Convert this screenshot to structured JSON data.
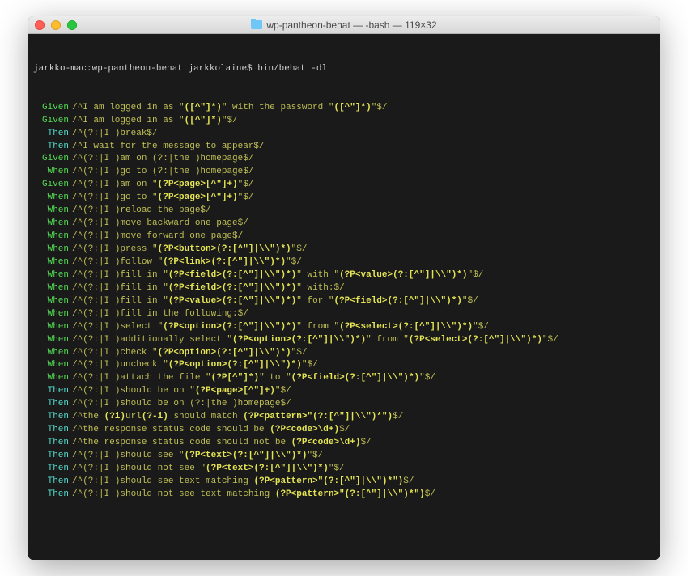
{
  "window": {
    "title_folder": "wp-pantheon-behat",
    "title_rest": " — -bash — 119×32"
  },
  "prompt": {
    "host": "jarkko-mac:",
    "dir": "wp-pantheon-behat",
    "user": " jarkkolaine$ ",
    "cmd": "bin/behat -dl"
  },
  "lines": [
    {
      "kw": "Given",
      "kwc": "given",
      "segs": [
        {
          "t": "/^I am logged in as \""
        },
        {
          "t": "([^\"]*)",
          "h": 1
        },
        {
          "t": "\" with the password \""
        },
        {
          "t": "([^\"]*)",
          "h": 1
        },
        {
          "t": "\"$/"
        }
      ]
    },
    {
      "kw": "Given",
      "kwc": "given",
      "segs": [
        {
          "t": "/^I am logged in as \""
        },
        {
          "t": "([^\"]*)",
          "h": 1
        },
        {
          "t": "\"$/"
        }
      ]
    },
    {
      "kw": "Then",
      "kwc": "then",
      "segs": [
        {
          "t": "/^(?:|I )break$/"
        }
      ]
    },
    {
      "kw": "Then",
      "kwc": "then",
      "segs": [
        {
          "t": "/^I wait for the message to appear$/"
        }
      ]
    },
    {
      "kw": "Given",
      "kwc": "given",
      "segs": [
        {
          "t": "/^(?:|I )am on (?:|the )homepage$/"
        }
      ]
    },
    {
      "kw": "When",
      "kwc": "when",
      "segs": [
        {
          "t": "/^(?:|I )go to (?:|the )homepage$/"
        }
      ]
    },
    {
      "kw": "Given",
      "kwc": "given",
      "segs": [
        {
          "t": "/^(?:|I )am on \""
        },
        {
          "t": "(?P<page>[^\"]+)",
          "h": 1
        },
        {
          "t": "\"$/"
        }
      ]
    },
    {
      "kw": "When",
      "kwc": "when",
      "segs": [
        {
          "t": "/^(?:|I )go to \""
        },
        {
          "t": "(?P<page>[^\"]+)",
          "h": 1
        },
        {
          "t": "\"$/"
        }
      ]
    },
    {
      "kw": "When",
      "kwc": "when",
      "segs": [
        {
          "t": "/^(?:|I )reload the page$/"
        }
      ]
    },
    {
      "kw": "When",
      "kwc": "when",
      "segs": [
        {
          "t": "/^(?:|I )move backward one page$/"
        }
      ]
    },
    {
      "kw": "When",
      "kwc": "when",
      "segs": [
        {
          "t": "/^(?:|I )move forward one page$/"
        }
      ]
    },
    {
      "kw": "When",
      "kwc": "when",
      "segs": [
        {
          "t": "/^(?:|I )press \""
        },
        {
          "t": "(?P<button>(?:[^\"]|\\\\\")*)",
          "h": 1
        },
        {
          "t": "\"$/"
        }
      ]
    },
    {
      "kw": "When",
      "kwc": "when",
      "segs": [
        {
          "t": "/^(?:|I )follow \""
        },
        {
          "t": "(?P<link>(?:[^\"]|\\\\\")*)",
          "h": 1
        },
        {
          "t": "\"$/"
        }
      ]
    },
    {
      "kw": "When",
      "kwc": "when",
      "segs": [
        {
          "t": "/^(?:|I )fill in \""
        },
        {
          "t": "(?P<field>(?:[^\"]|\\\\\")*)",
          "h": 1
        },
        {
          "t": "\" with \""
        },
        {
          "t": "(?P<value>(?:[^\"]|\\\\\")*)",
          "h": 1
        },
        {
          "t": "\"$/"
        }
      ]
    },
    {
      "kw": "When",
      "kwc": "when",
      "segs": [
        {
          "t": "/^(?:|I )fill in \""
        },
        {
          "t": "(?P<field>(?:[^\"]|\\\\\")*)",
          "h": 1
        },
        {
          "t": "\" with:$/"
        }
      ]
    },
    {
      "kw": "When",
      "kwc": "when",
      "segs": [
        {
          "t": "/^(?:|I )fill in \""
        },
        {
          "t": "(?P<value>(?:[^\"]|\\\\\")*)",
          "h": 1
        },
        {
          "t": "\" for \""
        },
        {
          "t": "(?P<field>(?:[^\"]|\\\\\")*)",
          "h": 1
        },
        {
          "t": "\"$/"
        }
      ]
    },
    {
      "kw": "When",
      "kwc": "when",
      "segs": [
        {
          "t": "/^(?:|I )fill in the following:$/"
        }
      ]
    },
    {
      "kw": "When",
      "kwc": "when",
      "segs": [
        {
          "t": "/^(?:|I )select \""
        },
        {
          "t": "(?P<option>(?:[^\"]|\\\\\")*)",
          "h": 1
        },
        {
          "t": "\" from \""
        },
        {
          "t": "(?P<select>(?:[^\"]|\\\\\")*)",
          "h": 1
        },
        {
          "t": "\"$/"
        }
      ]
    },
    {
      "kw": "When",
      "kwc": "when",
      "segs": [
        {
          "t": "/^(?:|I )additionally select \""
        },
        {
          "t": "(?P<option>(?:[^\"]|\\\\\")*)",
          "h": 1
        },
        {
          "t": "\" from \""
        },
        {
          "t": "(?P<select>(?:[^\"]|\\\\\")*)",
          "h": 1
        },
        {
          "t": "\"$/"
        }
      ]
    },
    {
      "kw": "When",
      "kwc": "when",
      "segs": [
        {
          "t": "/^(?:|I )check \""
        },
        {
          "t": "(?P<option>(?:[^\"]|\\\\\")*)",
          "h": 1
        },
        {
          "t": "\"$/"
        }
      ]
    },
    {
      "kw": "When",
      "kwc": "when",
      "segs": [
        {
          "t": "/^(?:|I )uncheck \""
        },
        {
          "t": "(?P<option>(?:[^\"]|\\\\\")*)",
          "h": 1
        },
        {
          "t": "\"$/"
        }
      ]
    },
    {
      "kw": "When",
      "kwc": "when",
      "segs": [
        {
          "t": "/^(?:|I )attach the file \""
        },
        {
          "t": "(?P[^\"]*)",
          "h": 1
        },
        {
          "t": "\" to \""
        },
        {
          "t": "(?P<field>(?:[^\"]|\\\\\")*)",
          "h": 1
        },
        {
          "t": "\"$/"
        }
      ]
    },
    {
      "kw": "Then",
      "kwc": "then",
      "segs": [
        {
          "t": "/^(?:|I )should be on \""
        },
        {
          "t": "(?P<page>[^\"]+)",
          "h": 1
        },
        {
          "t": "\"$/"
        }
      ]
    },
    {
      "kw": "Then",
      "kwc": "then",
      "segs": [
        {
          "t": "/^(?:|I )should be on (?:|the )homepage$/"
        }
      ]
    },
    {
      "kw": "Then",
      "kwc": "then",
      "segs": [
        {
          "t": "/^the "
        },
        {
          "t": "(?i)",
          "h": 1
        },
        {
          "t": "url"
        },
        {
          "t": "(?-i)",
          "h": 1
        },
        {
          "t": " should match "
        },
        {
          "t": "(?P<pattern>\"(?:[^\"]|\\\\\")*\")",
          "h": 1
        },
        {
          "t": "$/"
        }
      ]
    },
    {
      "kw": "Then",
      "kwc": "then",
      "segs": [
        {
          "t": "/^the response status code should be "
        },
        {
          "t": "(?P<code>\\d+)",
          "h": 1
        },
        {
          "t": "$/"
        }
      ]
    },
    {
      "kw": "Then",
      "kwc": "then",
      "segs": [
        {
          "t": "/^the response status code should not be "
        },
        {
          "t": "(?P<code>\\d+)",
          "h": 1
        },
        {
          "t": "$/"
        }
      ]
    },
    {
      "kw": "Then",
      "kwc": "then",
      "segs": [
        {
          "t": "/^(?:|I )should see \""
        },
        {
          "t": "(?P<text>(?:[^\"]|\\\\\")*)",
          "h": 1
        },
        {
          "t": "\"$/"
        }
      ]
    },
    {
      "kw": "Then",
      "kwc": "then",
      "segs": [
        {
          "t": "/^(?:|I )should not see \""
        },
        {
          "t": "(?P<text>(?:[^\"]|\\\\\")*)",
          "h": 1
        },
        {
          "t": "\"$/"
        }
      ]
    },
    {
      "kw": "Then",
      "kwc": "then",
      "segs": [
        {
          "t": "/^(?:|I )should see text matching "
        },
        {
          "t": "(?P<pattern>\"(?:[^\"]|\\\\\")*\")",
          "h": 1
        },
        {
          "t": "$/"
        }
      ]
    },
    {
      "kw": "Then",
      "kwc": "then",
      "segs": [
        {
          "t": "/^(?:|I )should not see text matching "
        },
        {
          "t": "(?P<pattern>\"(?:[^\"]|\\\\\")*\")",
          "h": 1
        },
        {
          "t": "$/"
        }
      ]
    }
  ]
}
